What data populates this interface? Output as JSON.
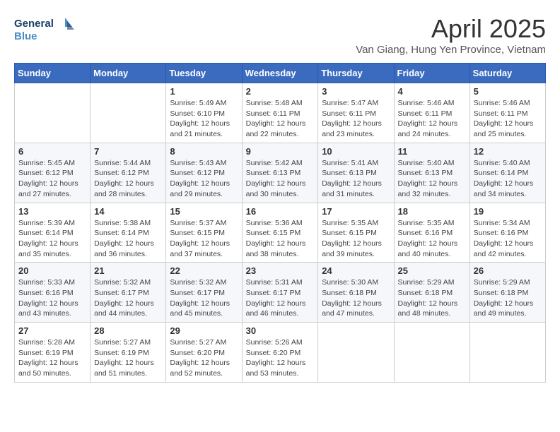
{
  "logo": {
    "line1": "General",
    "line2": "Blue"
  },
  "title": "April 2025",
  "subtitle": "Van Giang, Hung Yen Province, Vietnam",
  "weekdays": [
    "Sunday",
    "Monday",
    "Tuesday",
    "Wednesday",
    "Thursday",
    "Friday",
    "Saturday"
  ],
  "weeks": [
    [
      {
        "day": "",
        "info": ""
      },
      {
        "day": "",
        "info": ""
      },
      {
        "day": "1",
        "info": "Sunrise: 5:49 AM\nSunset: 6:10 PM\nDaylight: 12 hours and 21 minutes."
      },
      {
        "day": "2",
        "info": "Sunrise: 5:48 AM\nSunset: 6:11 PM\nDaylight: 12 hours and 22 minutes."
      },
      {
        "day": "3",
        "info": "Sunrise: 5:47 AM\nSunset: 6:11 PM\nDaylight: 12 hours and 23 minutes."
      },
      {
        "day": "4",
        "info": "Sunrise: 5:46 AM\nSunset: 6:11 PM\nDaylight: 12 hours and 24 minutes."
      },
      {
        "day": "5",
        "info": "Sunrise: 5:46 AM\nSunset: 6:11 PM\nDaylight: 12 hours and 25 minutes."
      }
    ],
    [
      {
        "day": "6",
        "info": "Sunrise: 5:45 AM\nSunset: 6:12 PM\nDaylight: 12 hours and 27 minutes."
      },
      {
        "day": "7",
        "info": "Sunrise: 5:44 AM\nSunset: 6:12 PM\nDaylight: 12 hours and 28 minutes."
      },
      {
        "day": "8",
        "info": "Sunrise: 5:43 AM\nSunset: 6:12 PM\nDaylight: 12 hours and 29 minutes."
      },
      {
        "day": "9",
        "info": "Sunrise: 5:42 AM\nSunset: 6:13 PM\nDaylight: 12 hours and 30 minutes."
      },
      {
        "day": "10",
        "info": "Sunrise: 5:41 AM\nSunset: 6:13 PM\nDaylight: 12 hours and 31 minutes."
      },
      {
        "day": "11",
        "info": "Sunrise: 5:40 AM\nSunset: 6:13 PM\nDaylight: 12 hours and 32 minutes."
      },
      {
        "day": "12",
        "info": "Sunrise: 5:40 AM\nSunset: 6:14 PM\nDaylight: 12 hours and 34 minutes."
      }
    ],
    [
      {
        "day": "13",
        "info": "Sunrise: 5:39 AM\nSunset: 6:14 PM\nDaylight: 12 hours and 35 minutes."
      },
      {
        "day": "14",
        "info": "Sunrise: 5:38 AM\nSunset: 6:14 PM\nDaylight: 12 hours and 36 minutes."
      },
      {
        "day": "15",
        "info": "Sunrise: 5:37 AM\nSunset: 6:15 PM\nDaylight: 12 hours and 37 minutes."
      },
      {
        "day": "16",
        "info": "Sunrise: 5:36 AM\nSunset: 6:15 PM\nDaylight: 12 hours and 38 minutes."
      },
      {
        "day": "17",
        "info": "Sunrise: 5:35 AM\nSunset: 6:15 PM\nDaylight: 12 hours and 39 minutes."
      },
      {
        "day": "18",
        "info": "Sunrise: 5:35 AM\nSunset: 6:16 PM\nDaylight: 12 hours and 40 minutes."
      },
      {
        "day": "19",
        "info": "Sunrise: 5:34 AM\nSunset: 6:16 PM\nDaylight: 12 hours and 42 minutes."
      }
    ],
    [
      {
        "day": "20",
        "info": "Sunrise: 5:33 AM\nSunset: 6:16 PM\nDaylight: 12 hours and 43 minutes."
      },
      {
        "day": "21",
        "info": "Sunrise: 5:32 AM\nSunset: 6:17 PM\nDaylight: 12 hours and 44 minutes."
      },
      {
        "day": "22",
        "info": "Sunrise: 5:32 AM\nSunset: 6:17 PM\nDaylight: 12 hours and 45 minutes."
      },
      {
        "day": "23",
        "info": "Sunrise: 5:31 AM\nSunset: 6:17 PM\nDaylight: 12 hours and 46 minutes."
      },
      {
        "day": "24",
        "info": "Sunrise: 5:30 AM\nSunset: 6:18 PM\nDaylight: 12 hours and 47 minutes."
      },
      {
        "day": "25",
        "info": "Sunrise: 5:29 AM\nSunset: 6:18 PM\nDaylight: 12 hours and 48 minutes."
      },
      {
        "day": "26",
        "info": "Sunrise: 5:29 AM\nSunset: 6:18 PM\nDaylight: 12 hours and 49 minutes."
      }
    ],
    [
      {
        "day": "27",
        "info": "Sunrise: 5:28 AM\nSunset: 6:19 PM\nDaylight: 12 hours and 50 minutes."
      },
      {
        "day": "28",
        "info": "Sunrise: 5:27 AM\nSunset: 6:19 PM\nDaylight: 12 hours and 51 minutes."
      },
      {
        "day": "29",
        "info": "Sunrise: 5:27 AM\nSunset: 6:20 PM\nDaylight: 12 hours and 52 minutes."
      },
      {
        "day": "30",
        "info": "Sunrise: 5:26 AM\nSunset: 6:20 PM\nDaylight: 12 hours and 53 minutes."
      },
      {
        "day": "",
        "info": ""
      },
      {
        "day": "",
        "info": ""
      },
      {
        "day": "",
        "info": ""
      }
    ]
  ]
}
